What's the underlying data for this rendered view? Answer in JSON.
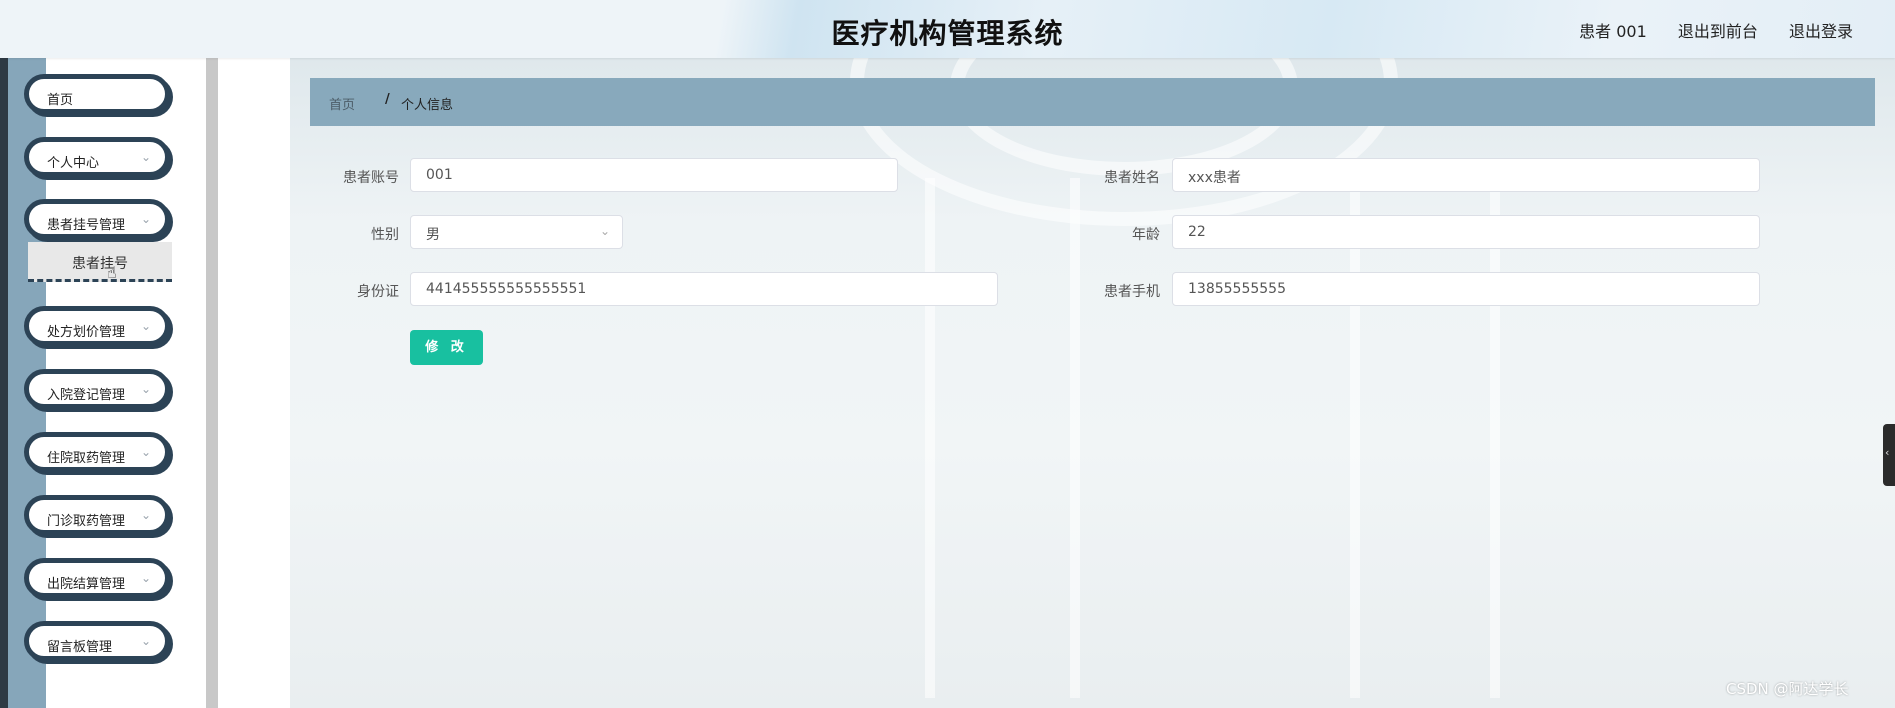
{
  "header": {
    "title": "医疗机构管理系统",
    "user": "患者 001",
    "front_link": "退出到前台",
    "logout_link": "退出登录"
  },
  "sidebar": {
    "items": [
      {
        "label": "首页",
        "has_chevron": false
      },
      {
        "label": "个人中心",
        "has_chevron": true
      },
      {
        "label": "患者挂号管理",
        "has_chevron": true,
        "expanded": true
      },
      {
        "label": "处方划价管理",
        "has_chevron": true
      },
      {
        "label": "入院登记管理",
        "has_chevron": true
      },
      {
        "label": "住院取药管理",
        "has_chevron": true
      },
      {
        "label": "门诊取药管理",
        "has_chevron": true
      },
      {
        "label": "出院结算管理",
        "has_chevron": true
      },
      {
        "label": "留言板管理",
        "has_chevron": true
      }
    ],
    "submenu": {
      "label": "患者挂号"
    },
    "icons": {
      "chevron": "chevron-down-icon",
      "cursor": "hand-pointer-icon"
    }
  },
  "breadcrumb": {
    "home": "首页",
    "separator": "/",
    "current": "个人信息"
  },
  "form": {
    "account": {
      "label": "患者账号",
      "value": "001"
    },
    "name": {
      "label": "患者姓名",
      "value": "xxx患者"
    },
    "gender": {
      "label": "性别",
      "value": "男"
    },
    "age": {
      "label": "年龄",
      "value": "22"
    },
    "id_card": {
      "label": "身份证",
      "value": "441455555555555551"
    },
    "phone": {
      "label": "患者手机",
      "value": "13855555555"
    },
    "submit_label": "修 改"
  },
  "watermark": "CSDN @阿达学长",
  "colors": {
    "sidebar_dark": "#2c4356",
    "sidebar_stripe": "#86a6ba",
    "breadcrumb_bg": "#88a9bc",
    "button_bg": "#18c0a0"
  }
}
